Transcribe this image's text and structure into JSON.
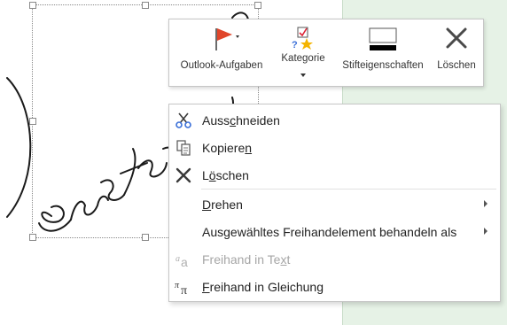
{
  "toolbar": {
    "items": [
      {
        "label": "Outlook-Aufgaben",
        "icon": "flag-icon",
        "has_dropdown": true
      },
      {
        "label": "Kategorie",
        "icon": "category-icon",
        "has_dropdown": true
      },
      {
        "label": "Stifteigenschaften",
        "icon": "pen-properties-icon",
        "has_dropdown": false
      },
      {
        "label": "Löschen",
        "icon": "delete-x-icon",
        "has_dropdown": false
      }
    ]
  },
  "menu": {
    "items": [
      {
        "pre": "Auss",
        "key": "c",
        "post": "hneiden",
        "icon": "scissors-icon",
        "enabled": true,
        "submenu": false
      },
      {
        "pre": "Kopiere",
        "key": "n",
        "post": "",
        "icon": "copy-icon",
        "enabled": true,
        "submenu": false
      },
      {
        "pre": "L",
        "key": "ö",
        "post": "schen",
        "icon": "delete-x-icon",
        "enabled": true,
        "submenu": false
      },
      {
        "pre": "",
        "key": "D",
        "post": "rehen",
        "icon": "",
        "enabled": true,
        "submenu": true
      },
      {
        "pre": "Aus",
        "key": "g",
        "post": "ewähltes Freihandelement behandeln als",
        "icon": "",
        "enabled": true,
        "submenu": true
      },
      {
        "pre": "Freihand in Te",
        "key": "x",
        "post": "t",
        "icon": "ink-to-text-icon",
        "enabled": false,
        "submenu": false
      },
      {
        "pre": "",
        "key": "F",
        "post": "reihand in Gleichung",
        "icon": "ink-to-math-icon",
        "enabled": true,
        "submenu": false
      }
    ]
  },
  "colors": {
    "flag": "#e0452a",
    "star": "#f4b400",
    "check": "#3a6fd8",
    "pane": "#e6f2e6"
  }
}
